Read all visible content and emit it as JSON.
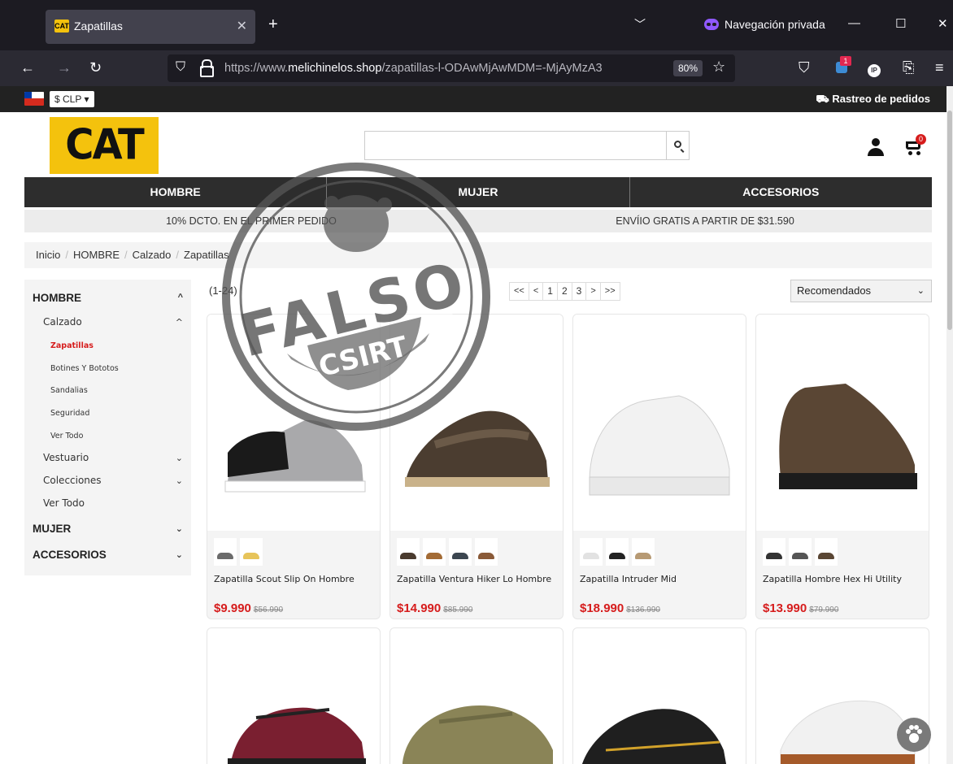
{
  "browser": {
    "tab_title": "Zapatillas",
    "tab_favicon_text": "CAT",
    "private_label": "Navegación privada",
    "url_prefix": "https://www.",
    "url_domain": "melichinelos.shop",
    "url_path": "/zapatillas-l-ODAwMjAwMDM=-MjAyMzA3",
    "zoom": "80%",
    "extension_badge": "1"
  },
  "topbar": {
    "currency": "$ CLP ▾",
    "tracking": "⛟ Rastreo de pedidos"
  },
  "header": {
    "logo_text": "CAT",
    "search_placeholder": "",
    "cart_count": "0"
  },
  "nav": {
    "categories": [
      "HOMBRE",
      "MUJER",
      "ACCESORIOS"
    ]
  },
  "promo": {
    "left": "10% DCTO. EN EL PRIMER PEDIDO",
    "right": "ENVÍIO GRATIS A PARTIR DE $31.590"
  },
  "breadcrumb": [
    "Inicio",
    "HOMBRE",
    "Calzado",
    "Zapatillas"
  ],
  "sidebar": {
    "items": [
      {
        "label": "HOMBRE",
        "level": 0,
        "chev": "^"
      },
      {
        "label": "Calzado",
        "level": 1,
        "chev": "^"
      },
      {
        "label": "Zapatillas",
        "level": 2,
        "active": true
      },
      {
        "label": "Botines Y Bototos",
        "level": 2
      },
      {
        "label": "Sandalias",
        "level": 2
      },
      {
        "label": "Seguridad",
        "level": 2
      },
      {
        "label": "Ver Todo",
        "level": 2
      },
      {
        "label": "Vestuario",
        "level": 1,
        "chev": "⌄"
      },
      {
        "label": "Colecciones",
        "level": 1,
        "chev": "⌄"
      },
      {
        "label": "Ver Todo",
        "level": 1
      },
      {
        "label": "MUJER",
        "level": 0,
        "chev": "⌄"
      },
      {
        "label": "ACCESORIOS",
        "level": 0,
        "chev": "⌄"
      }
    ]
  },
  "listing": {
    "count": "(1-24)",
    "pagination": [
      "<<",
      "<",
      "1",
      "2",
      "3",
      ">",
      ">>"
    ],
    "sort": "Recomendados"
  },
  "products": [
    {
      "name": "Zapatilla Scout Slip On Hombre",
      "price": "$9.990",
      "old": "$56.990",
      "thumbs": [
        "#6b6b6b",
        "#e7c45a"
      ]
    },
    {
      "name": "Zapatilla Ventura Hiker Lo Hombre",
      "price": "$14.990",
      "old": "$85.990",
      "thumbs": [
        "#4a3b2e",
        "#a36b35",
        "#3c4650",
        "#8a5a38"
      ]
    },
    {
      "name": "Zapatilla Intruder Mid",
      "price": "$18.990",
      "old": "$136.990",
      "thumbs": [
        "#e2e2e2",
        "#222222",
        "#b79a74"
      ]
    },
    {
      "name": "Zapatilla Hombre Hex Hi Utility",
      "price": "$13.990",
      "old": "$79.990",
      "thumbs": [
        "#333333",
        "#555555",
        "#5a4634"
      ]
    }
  ],
  "stamp": {
    "word": "FALSO",
    "org": "CSIRT"
  },
  "colors": {
    "accent_red": "#d61c1c",
    "brand_yellow": "#f4c20d",
    "nav_dark": "#2d2d2d"
  }
}
